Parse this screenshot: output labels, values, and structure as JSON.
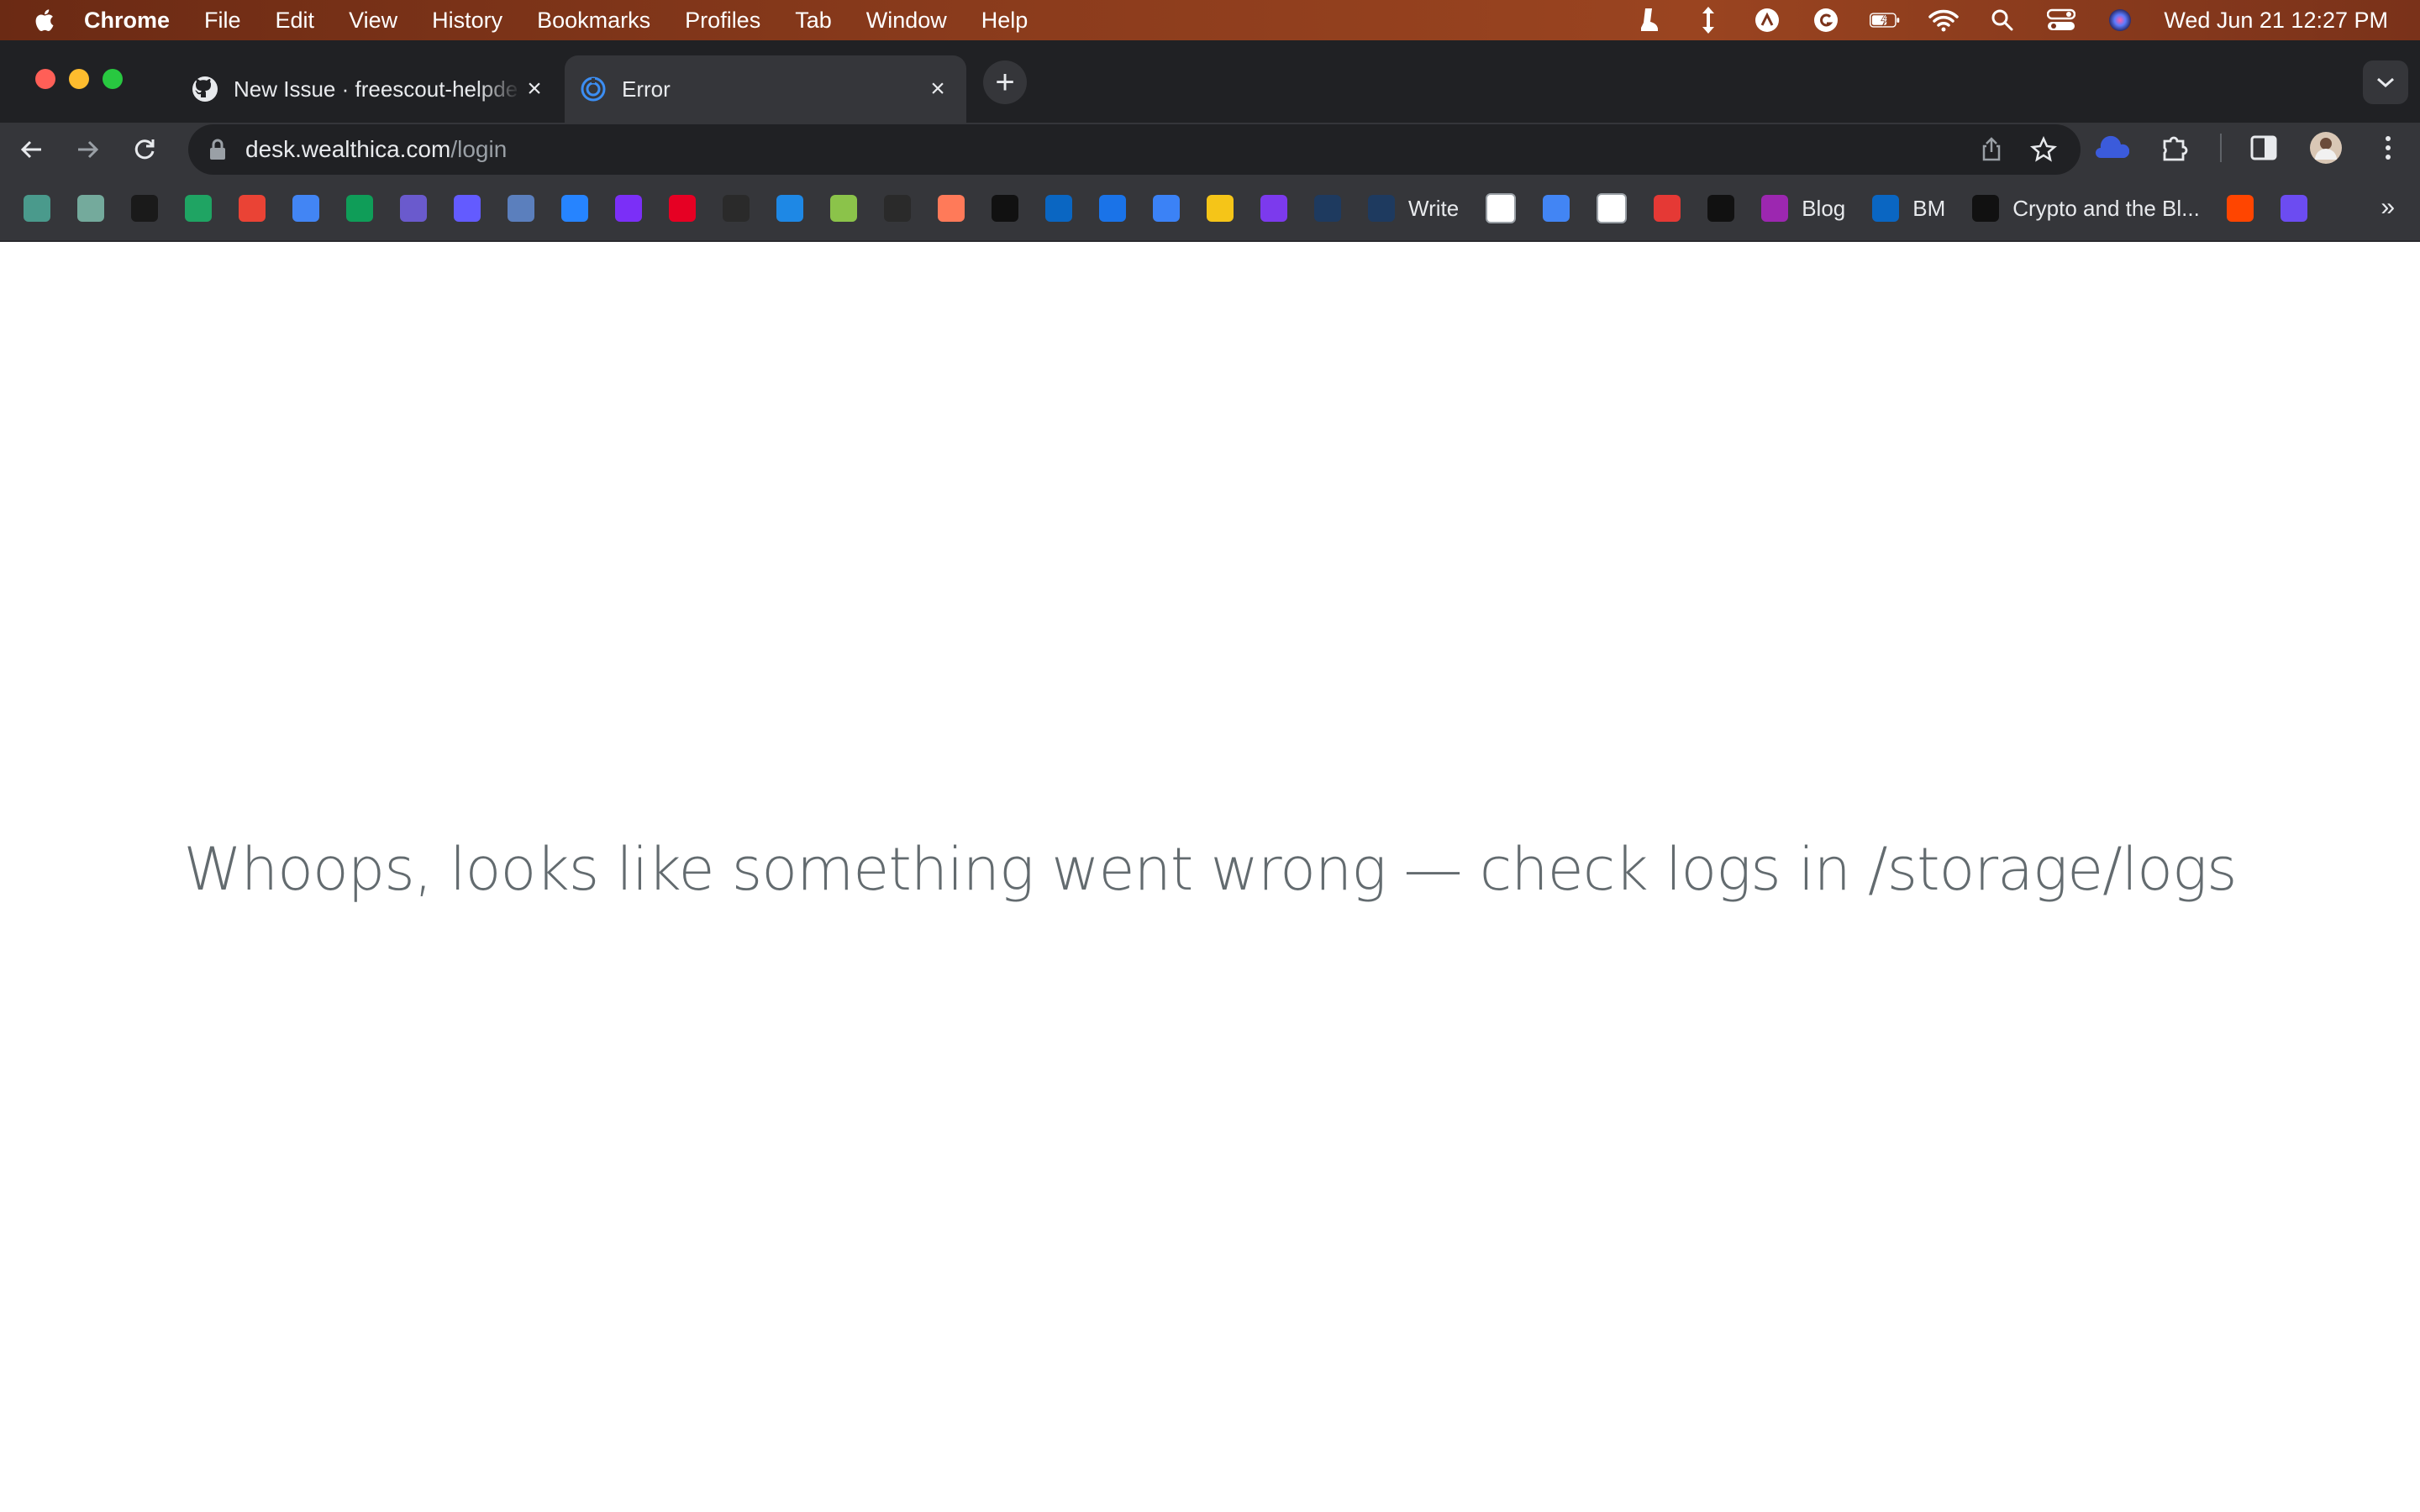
{
  "menubar": {
    "app_name": "Chrome",
    "items": [
      "File",
      "Edit",
      "View",
      "History",
      "Bookmarks",
      "Profiles",
      "Tab",
      "Window",
      "Help"
    ],
    "clock": "Wed Jun 21  12:27 PM",
    "status_icons": [
      "boot-icon",
      "arrows-vertical-icon",
      "creative-cloud-icon",
      "grammarly-icon",
      "battery-icon",
      "wifi-icon",
      "spotlight-search-icon",
      "control-center-icon",
      "siri-icon"
    ]
  },
  "tabs": [
    {
      "title": "New Issue · freescout-helpde",
      "favicon": "github-icon",
      "active": false
    },
    {
      "title": "Error",
      "favicon": "spiral-icon",
      "active": true
    }
  ],
  "address_bar": {
    "host": "desk.wealthica.com",
    "path": "/login"
  },
  "bookmarks": [
    {
      "icon": "check-icon",
      "color": "#4a9a8c",
      "label": ""
    },
    {
      "icon": "openai-icon",
      "color": "#74aa9c",
      "label": ""
    },
    {
      "icon": "g-badge-icon",
      "color": "#1a1a1a",
      "label": ""
    },
    {
      "icon": "drive-icon",
      "color": "#1fa463",
      "label": ""
    },
    {
      "icon": "gmail-icon",
      "color": "#ea4335",
      "label": ""
    },
    {
      "icon": "calendar-icon",
      "color": "#4285f4",
      "label": ""
    },
    {
      "icon": "sheets-plus-icon",
      "color": "#0f9d58",
      "label": ""
    },
    {
      "icon": "x-cross-icon",
      "color": "#6a5acd",
      "label": ""
    },
    {
      "icon": "s-icon",
      "color": "#635bff",
      "label": ""
    },
    {
      "icon": "forms-icon",
      "color": "#5b7fbd",
      "label": ""
    },
    {
      "icon": "jira-icon",
      "color": "#2684ff",
      "label": ""
    },
    {
      "icon": "hexagon-icon",
      "color": "#7b2ff7",
      "label": ""
    },
    {
      "icon": "pinterest-icon",
      "color": "#e60023",
      "label": ""
    },
    {
      "icon": "k-icon",
      "color": "#2a2a2a",
      "label": ""
    },
    {
      "icon": "spiral-icon",
      "color": "#1e88e5",
      "label": ""
    },
    {
      "icon": "bird-icon",
      "color": "#8bc34a",
      "label": ""
    },
    {
      "icon": "g-lowercase-icon",
      "color": "#2a2a2a",
      "label": ""
    },
    {
      "icon": "hubspot-icon",
      "color": "#ff7a59",
      "label": ""
    },
    {
      "icon": "p-icon",
      "color": "#111111",
      "label": ""
    },
    {
      "icon": "linkedin-icon",
      "color": "#0a66c2",
      "label": ""
    },
    {
      "icon": "onepassword-icon",
      "color": "#1a73e8",
      "label": ""
    },
    {
      "icon": "goggles-icon",
      "color": "#3b82f6",
      "label": ""
    },
    {
      "icon": "warning-triangle-icon",
      "color": "#f5c518",
      "label": ""
    },
    {
      "icon": "diamond-icon",
      "color": "#7c3aed",
      "label": ""
    },
    {
      "icon": "shield-hex-icon",
      "color": "#1e3a5f",
      "label": ""
    },
    {
      "icon": "shield-hex-icon",
      "color": "#1e3a5f",
      "label": "Write"
    },
    {
      "icon": "google-icon",
      "color": "#ffffff",
      "label": ""
    },
    {
      "icon": "translate-icon",
      "color": "#4285f4",
      "label": ""
    },
    {
      "icon": "circle-slash-icon",
      "color": "#ffffff",
      "label": ""
    },
    {
      "icon": "t-icon",
      "color": "#e53935",
      "label": ""
    },
    {
      "icon": "p-pixel-icon",
      "color": "#111111",
      "label": ""
    },
    {
      "icon": "orb-icon",
      "color": "#9c27b0",
      "label": "Blog"
    },
    {
      "icon": "linkedin-icon",
      "color": "#0a66c2",
      "label": "BM"
    },
    {
      "icon": "medium-icon",
      "color": "#111111",
      "label": "Crypto and the Bl..."
    },
    {
      "icon": "reddit-icon",
      "color": "#ff4500",
      "label": ""
    },
    {
      "icon": "gear-purple-icon",
      "color": "#6c4cf1",
      "label": ""
    }
  ],
  "page": {
    "error_message": "Whoops, looks like something went wrong — check logs in /storage/logs"
  }
}
